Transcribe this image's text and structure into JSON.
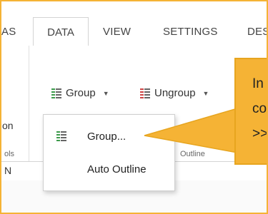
{
  "tabs": [
    {
      "label": "AS",
      "active": false
    },
    {
      "label": "DATA",
      "active": true
    },
    {
      "label": "VIEW",
      "active": false
    },
    {
      "label": "SETTINGS",
      "active": false
    },
    {
      "label": "DES",
      "active": false
    }
  ],
  "ribbon": {
    "left_partial_label": "on",
    "left_partial_group": "ols",
    "group_button": "Group",
    "ungroup_button": "Ungroup",
    "group_caption": "Outline"
  },
  "dropdown": {
    "items": [
      {
        "label": "Group...",
        "icon": "group-icon"
      },
      {
        "label": "Auto Outline",
        "icon": ""
      }
    ]
  },
  "formula_bar": {
    "cell_ref_partial": "N"
  },
  "tooltip": {
    "lines": [
      "In",
      "co",
      ">>"
    ]
  },
  "colors": {
    "accent": "#f5b335",
    "frame_border": "#f5b335"
  }
}
